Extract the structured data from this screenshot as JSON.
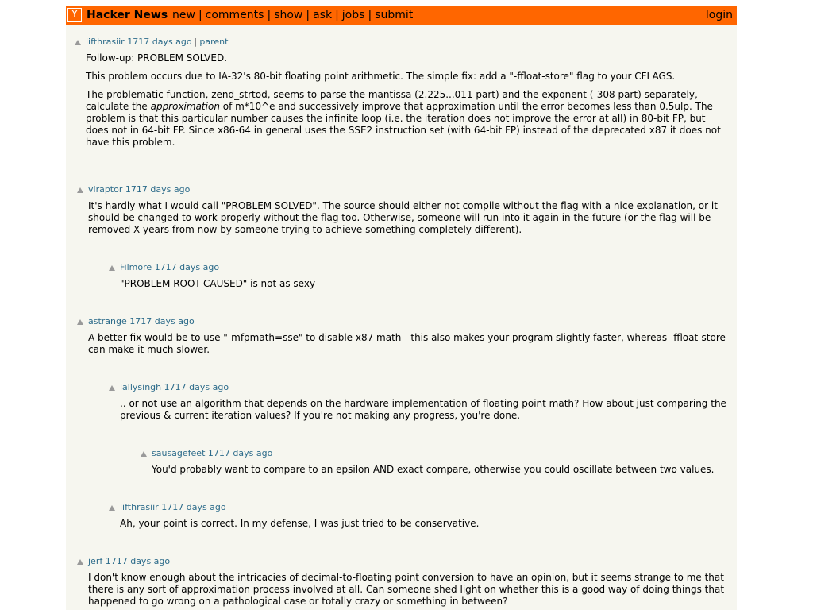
{
  "header": {
    "logo_letter": "Y",
    "site_title": "Hacker News",
    "nav": [
      "new",
      "comments",
      "show",
      "ask",
      "jobs",
      "submit"
    ],
    "separator": "|",
    "login": "login",
    "color": "#ff6600"
  },
  "comments": [
    {
      "user": "lifthrasiir",
      "age": "1717 days ago",
      "parent_label": "parent",
      "separator": "|",
      "paragraphs": [
        "Follow-up: PROBLEM SOLVED.",
        "This problem occurs due to IA-32's 80-bit floating point arithmetic. The simple fix: add a \"-ffloat-store\" flag to your CFLAGS."
      ],
      "p3_before": "The problematic function, zend_strtod, seems to parse the mantissa (2.225...011 part) and the exponent (-308 part) separately, calculate the ",
      "p3_em": "approximation",
      "p3_after": " of m*10^e and successively improve that approximation until the error becomes less than 0.5ulp. The problem is that this particular number causes the infinite loop (i.e. the iteration does not improve the error at all) in 80-bit FP, but does not in 64-bit FP. Since x86-64 in general uses the SSE2 instruction set (with 64-bit FP) instead of the deprecated x87 it does not have this problem."
    },
    {
      "user": "viraptor",
      "age": "1717 days ago",
      "text": "It's hardly what I would call \"PROBLEM SOLVED\". The source should either not compile without the flag with a nice explanation, or it should be changed to work properly without the flag too. Otherwise, someone will run into it again in the future (or the flag will be removed X years from now by someone trying to achieve something completely different)."
    },
    {
      "user": "Filmore",
      "age": "1717 days ago",
      "text": "\"PROBLEM ROOT-CAUSED\" is not as sexy"
    },
    {
      "user": "astrange",
      "age": "1717 days ago",
      "text": "A better fix would be to use \"-mfpmath=sse\" to disable x87 math - this also makes your program slightly faster, whereas -ffloat-store can make it much slower."
    },
    {
      "user": "lallysingh",
      "age": "1717 days ago",
      "text": ".. or not use an algorithm that depends on the hardware implementation of floating point math? How about just comparing the previous & current iteration values? If you're not making any progress, you're done."
    },
    {
      "user": "sausagefeet",
      "age": "1717 days ago",
      "text": "You'd probably want to compare to an epsilon AND exact compare, otherwise you could oscillate between two values."
    },
    {
      "user": "lifthrasiir",
      "age": "1717 days ago",
      "text": "Ah, your point is correct. In my defense, I was just tried to be conservative."
    },
    {
      "user": "jerf",
      "age": "1717 days ago",
      "text": "I don't know enough about the intricacies of decimal-to-floating point conversion to have an opinion, but it seems strange to me that there is any sort of approximation process involved at all. Can someone shed light on whether this is a good way of doing things that happened to go wrong on a pathological case or totally crazy or something in between?"
    }
  ]
}
